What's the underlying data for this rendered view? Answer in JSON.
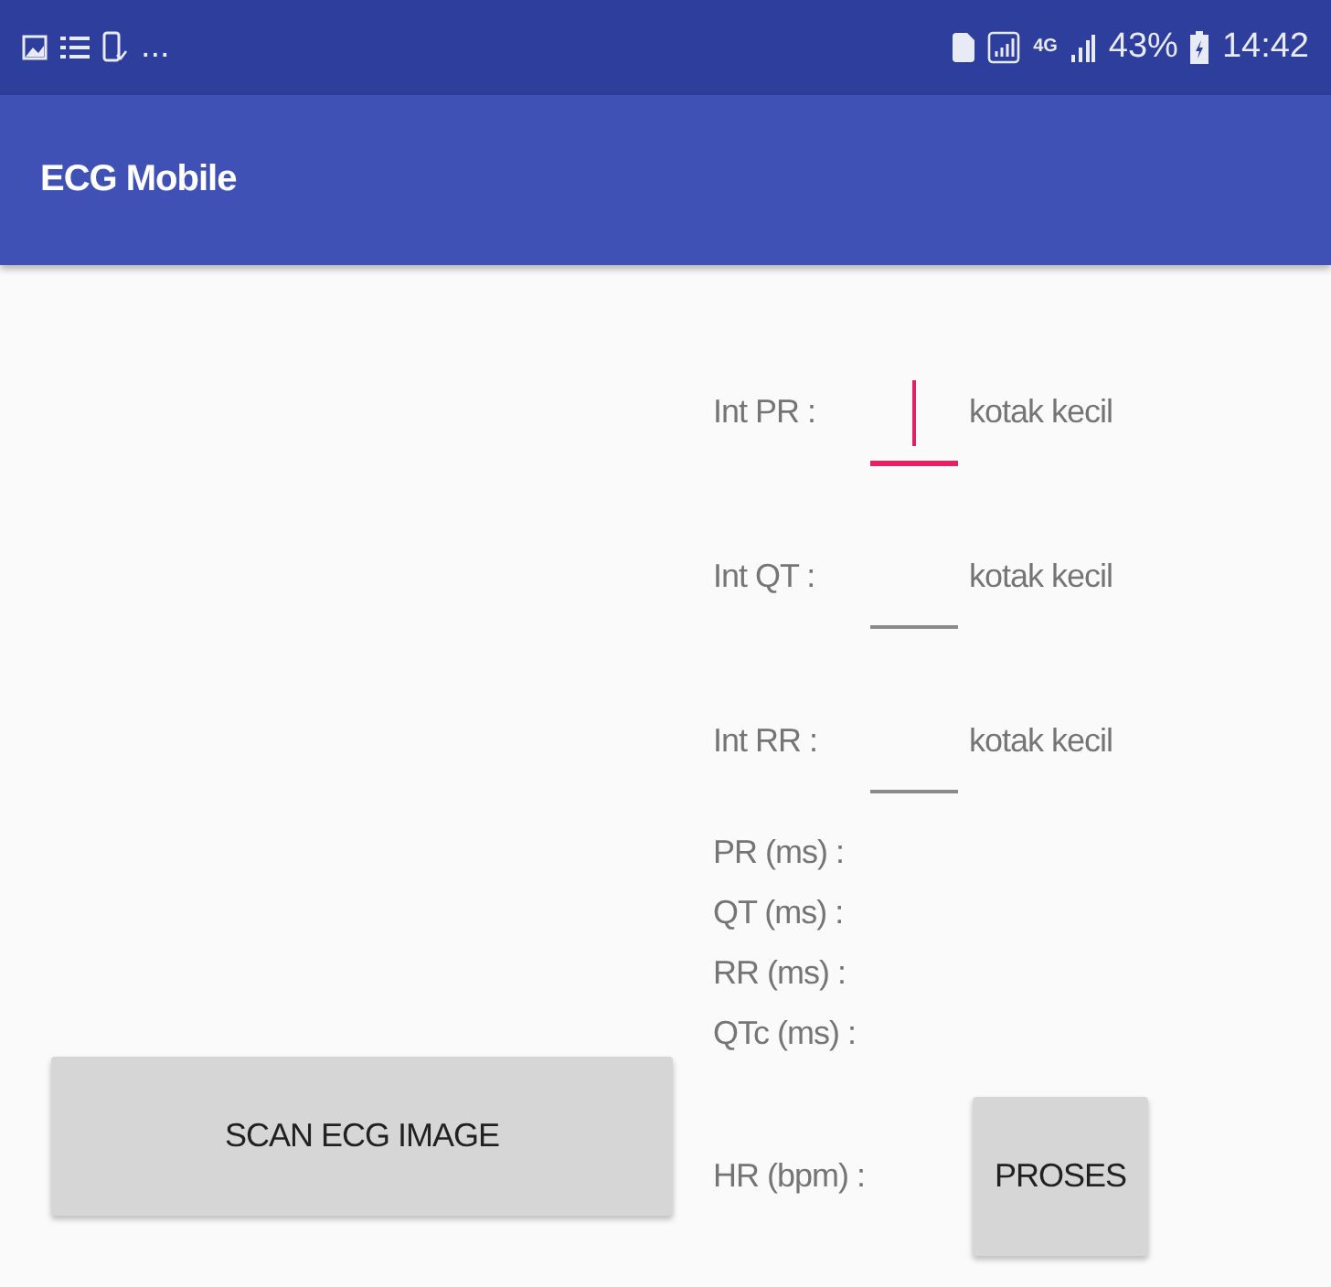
{
  "status_bar": {
    "more": "...",
    "network": "4G",
    "battery": "43%",
    "time": "14:42"
  },
  "app_bar": {
    "title": "ECG Mobile"
  },
  "inputs": [
    {
      "label": "Int PR :",
      "unit": "kotak kecil",
      "focused": true
    },
    {
      "label": "Int QT :",
      "unit": "kotak kecil",
      "focused": false
    },
    {
      "label": "Int RR :",
      "unit": "kotak kecil",
      "focused": false
    }
  ],
  "results": [
    "PR (ms) :",
    "QT (ms) :",
    "RR (ms) :",
    "QTc (ms) :"
  ],
  "hr_label": "HR (bpm) :",
  "buttons": {
    "scan": "SCAN ECG IMAGE",
    "process": "PROSES"
  }
}
